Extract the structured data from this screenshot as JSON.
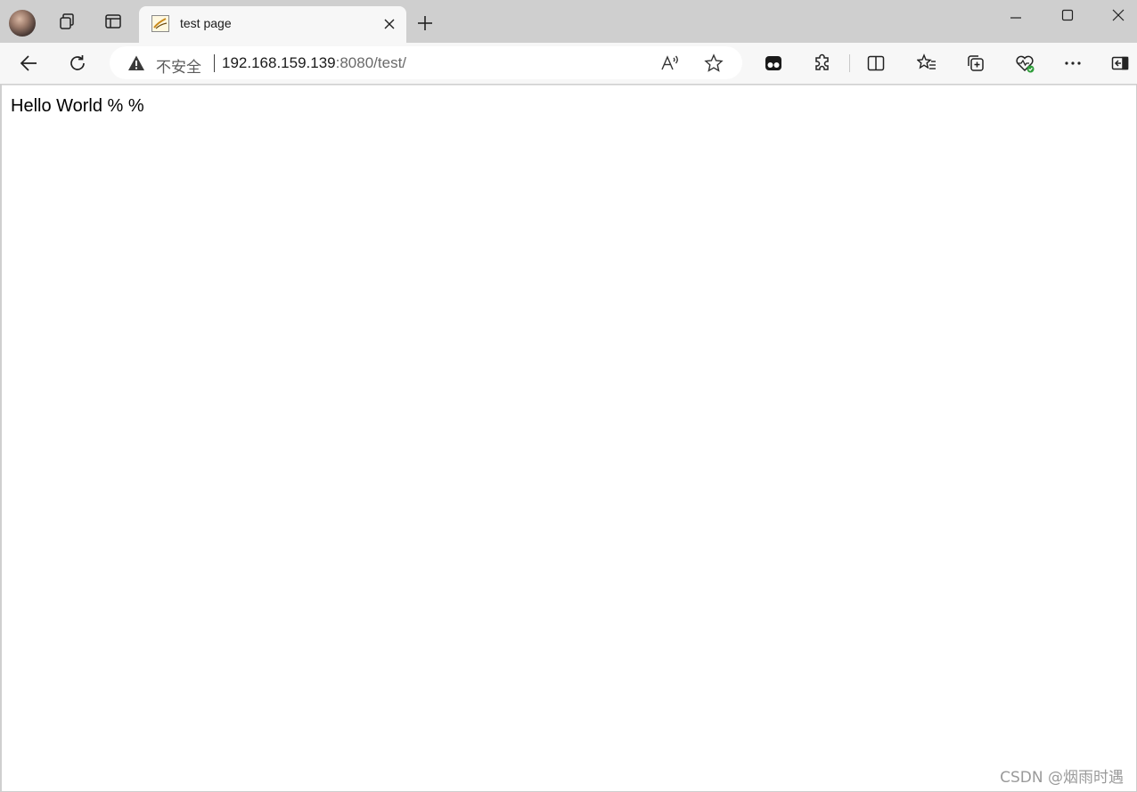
{
  "tab": {
    "title": "test page"
  },
  "address_bar": {
    "security_label": "不安全",
    "host": "192.168.159.139",
    "path": ":8080/test/"
  },
  "page": {
    "text": "Hello World % %"
  },
  "watermark": "CSDN @烟雨时遇",
  "icons": {
    "titlebar": [
      "avatar",
      "workspaces-icon",
      "vertical-tabs-icon",
      "close-tab-icon",
      "new-tab-icon",
      "minimize-icon",
      "maximize-icon",
      "close-window-icon"
    ],
    "toolbar": [
      "back-icon",
      "refresh-icon",
      "warning-icon",
      "read-aloud-icon",
      "favorite-star-icon",
      "tab-actions-icon",
      "extensions-icon",
      "split-screen-icon",
      "favorites-icon",
      "collections-icon",
      "browser-essentials-icon",
      "more-options-icon",
      "sidebar-toggle-icon"
    ]
  }
}
